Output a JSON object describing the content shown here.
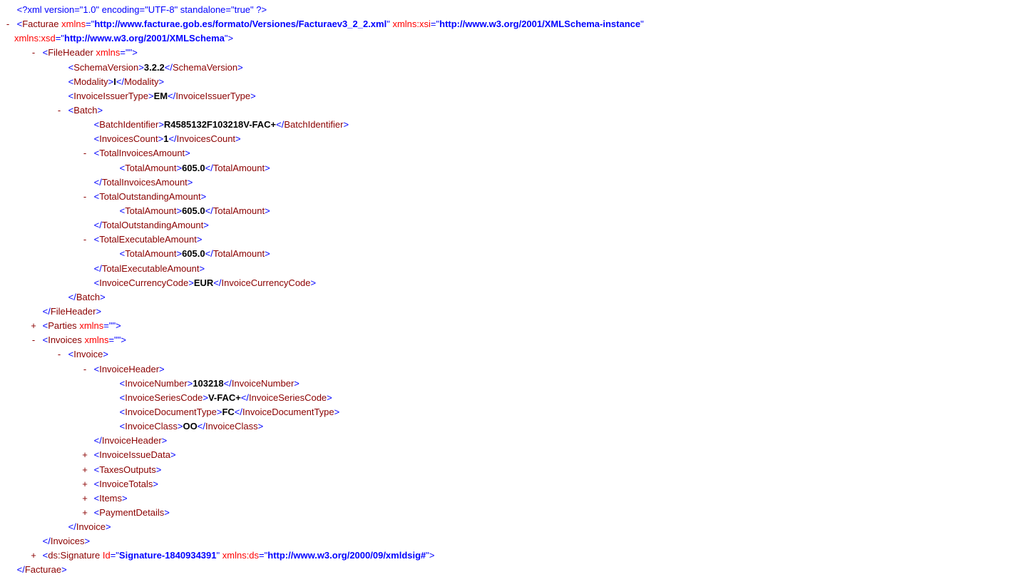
{
  "xmldecl": {
    "version": "1.0",
    "encoding": "UTF-8",
    "standalone": "true"
  },
  "root": {
    "name": "Facturae",
    "xmlns": "http://www.facturae.gob.es/formato/Versiones/Facturaev3_2_2.xml",
    "xmlns_xsi": "http://www.w3.org/2001/XMLSchema-instance",
    "xmlns_xsd": "http://www.w3.org/2001/XMLSchema"
  },
  "fileHeader": {
    "name": "FileHeader",
    "xmlns": "",
    "SchemaVersion": "3.2.2",
    "Modality": "I",
    "InvoiceIssuerType": "EM"
  },
  "batch": {
    "name": "Batch",
    "BatchIdentifier": "R4585132F103218V-FAC+",
    "InvoicesCount": "1",
    "TotalInvoicesAmount": {
      "TotalAmount": "605.0"
    },
    "TotalOutstandingAmount": {
      "TotalAmount": "605.0"
    },
    "TotalExecutableAmount": {
      "TotalAmount": "605.0"
    },
    "InvoiceCurrencyCode": "EUR"
  },
  "parties": {
    "name": "Parties",
    "xmlns": ""
  },
  "invoices": {
    "name": "Invoices",
    "xmlns": ""
  },
  "invoice": {
    "name": "Invoice"
  },
  "invoiceHeader": {
    "name": "InvoiceHeader",
    "InvoiceNumber": "103218",
    "InvoiceSeriesCode": "V-FAC+",
    "InvoiceDocumentType": "FC",
    "InvoiceClass": "OO"
  },
  "collapsedChildren": {
    "InvoiceIssueData": "InvoiceIssueData",
    "TaxesOutputs": "TaxesOutputs",
    "InvoiceTotals": "InvoiceTotals",
    "Items": "Items",
    "PaymentDetails": "PaymentDetails"
  },
  "signature": {
    "name": "ds:Signature",
    "Id": "Signature-1840934391",
    "xmlns_ds": "http://www.w3.org/2000/09/xmldsig#"
  }
}
